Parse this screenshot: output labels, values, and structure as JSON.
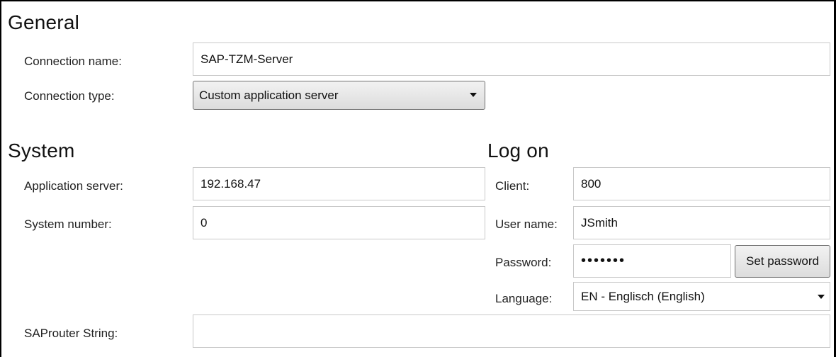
{
  "general": {
    "title": "General",
    "connection_name": {
      "label": "Connection name:",
      "value": "SAP-TZM-Server"
    },
    "connection_type": {
      "label": "Connection type:",
      "value": "Custom application server"
    }
  },
  "system": {
    "title": "System",
    "application_server": {
      "label": "Application server:",
      "value": "192.168.47"
    },
    "system_number": {
      "label": "System number:",
      "value": "0"
    },
    "saprouter": {
      "label": "SAProuter String:",
      "value": ""
    }
  },
  "logon": {
    "title": "Log on",
    "client": {
      "label": "Client:",
      "value": "800"
    },
    "user_name": {
      "label": "User name:",
      "value": "JSmith"
    },
    "password": {
      "label": "Password:",
      "value": "•••••••"
    },
    "set_password_label": "Set password",
    "language": {
      "label": "Language:",
      "value": "EN - Englisch (English)"
    }
  },
  "icons": {
    "dropdown": "chevron-down-icon"
  }
}
